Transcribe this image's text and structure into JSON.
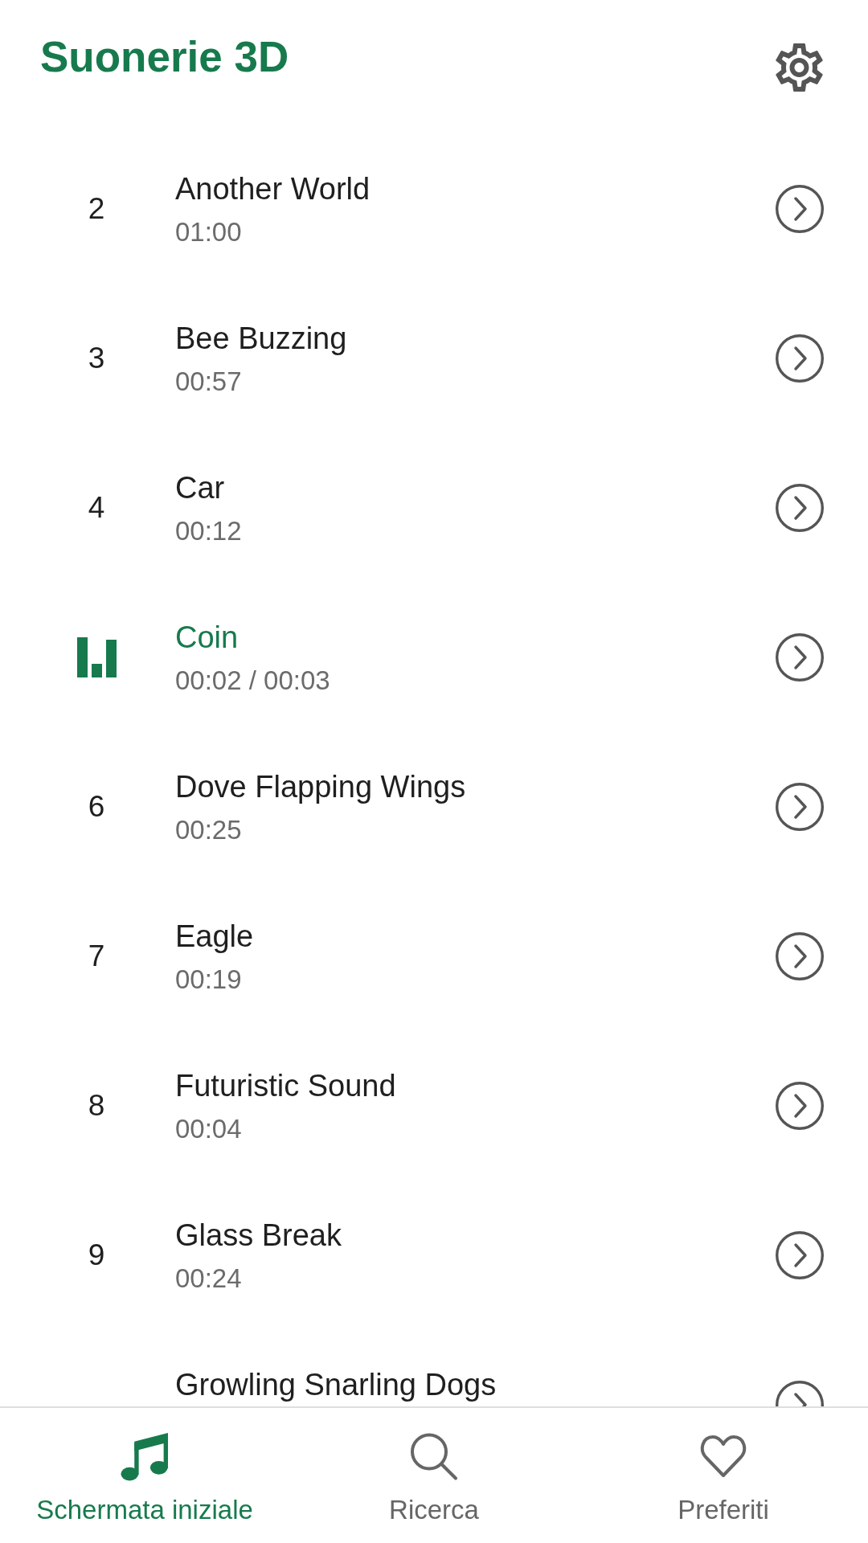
{
  "header": {
    "title": "Suonerie 3D"
  },
  "rows": [
    {
      "number": "2",
      "title": "Another World",
      "time": "01:00",
      "playing": false
    },
    {
      "number": "3",
      "title": "Bee Buzzing",
      "time": "00:57",
      "playing": false
    },
    {
      "number": "4",
      "title": "Car",
      "time": "00:12",
      "playing": false
    },
    {
      "title": "Coin",
      "time": "00:02 / 00:03",
      "playing": true
    },
    {
      "number": "6",
      "title": "Dove Flapping Wings",
      "time": "00:25",
      "playing": false
    },
    {
      "number": "7",
      "title": "Eagle",
      "time": "00:19",
      "playing": false
    },
    {
      "number": "8",
      "title": "Futuristic Sound",
      "time": "00:04",
      "playing": false
    },
    {
      "number": "9",
      "title": "Glass Break",
      "time": "00:24",
      "playing": false
    },
    {
      "title": "Growling Snarling Dogs",
      "playing": false
    }
  ],
  "nav": [
    {
      "label": "Schermata iniziale",
      "selected": true
    },
    {
      "label": "Ricerca",
      "selected": false
    },
    {
      "label": "Preferiti",
      "selected": false
    }
  ]
}
